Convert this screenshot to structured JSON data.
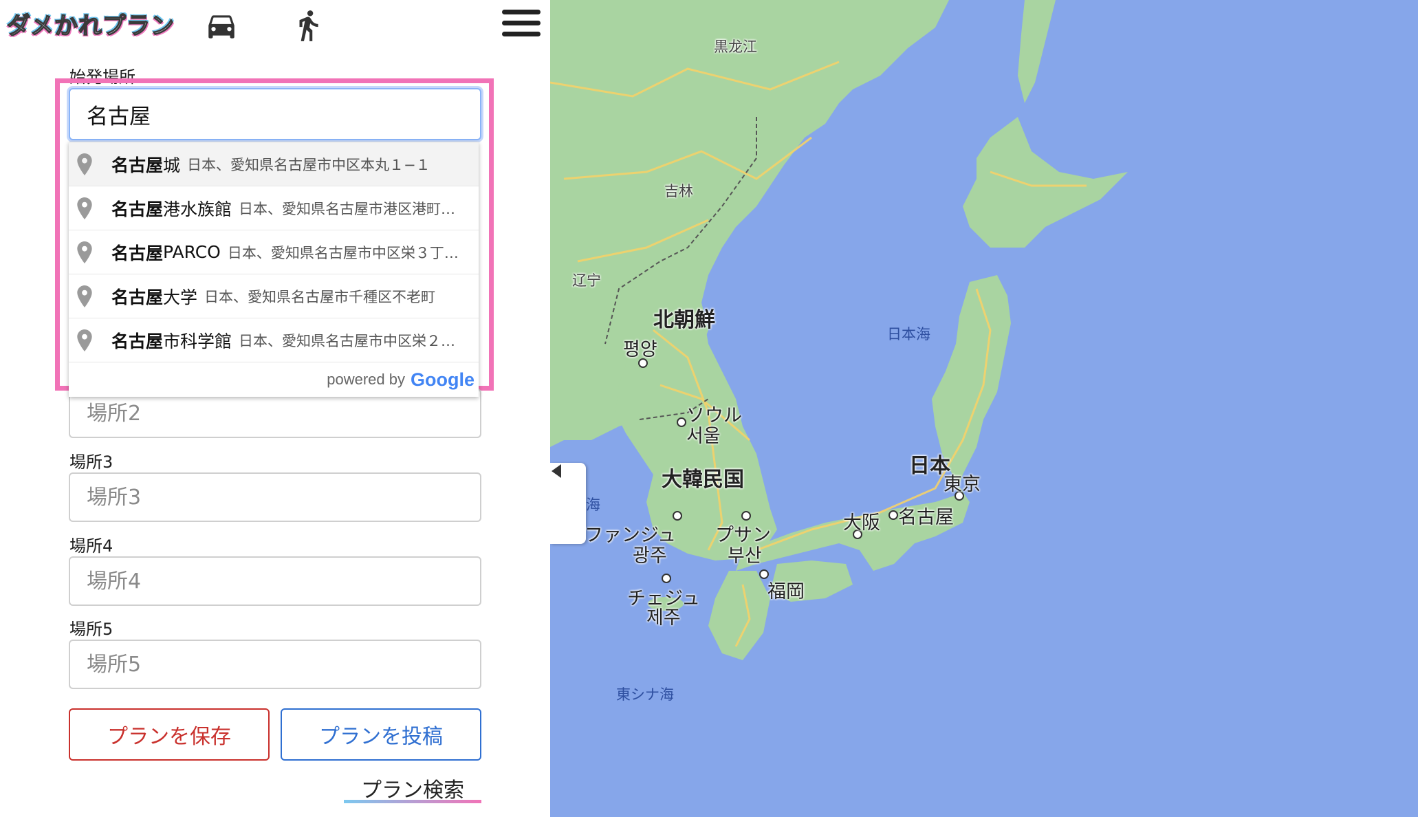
{
  "app": {
    "logo_text": "ダメかれプラン"
  },
  "header": {
    "car_icon": "car-icon",
    "walk_icon": "walk-icon",
    "menu_icon": "hamburger-menu-icon"
  },
  "form": {
    "start": {
      "label": "始発場所",
      "value": "名古屋"
    },
    "autocomplete": {
      "items": [
        {
          "match": "名古屋",
          "rest": "城",
          "address": "日本、愛知県名古屋市中区本丸１−１"
        },
        {
          "match": "名古屋",
          "rest": "港水族館",
          "address": "日本、愛知県名古屋市港区港町…"
        },
        {
          "match": "名古屋",
          "rest": "PARCO",
          "address": "日本、愛知県名古屋市中区栄３丁…"
        },
        {
          "match": "名古屋",
          "rest": "大学",
          "address": "日本、愛知県名古屋市千種区不老町"
        },
        {
          "match": "名古屋",
          "rest": "市科学館",
          "address": "日本、愛知県名古屋市中区栄２…"
        }
      ],
      "powered_by": "powered by",
      "google": "Google"
    },
    "place2": {
      "placeholder": "場所2"
    },
    "place3": {
      "label": "場所3",
      "placeholder": "場所3"
    },
    "place4": {
      "label": "場所4",
      "placeholder": "場所4"
    },
    "place5": {
      "label": "場所5",
      "placeholder": "場所5"
    },
    "save_label": "プランを保存",
    "post_label": "プランを投稿",
    "search_label": "プラン検索"
  },
  "colors": {
    "highlight": "#f173b7",
    "save": "#c9302c",
    "post": "#2f6fd1",
    "sea": "#86a6ea",
    "land": "#a8d5a0"
  },
  "map": {
    "labels": {
      "heilongjiang": "黒龙江",
      "jilin": "吉林",
      "liaoning": "辽宁",
      "north_korea": "北朝鮮",
      "pyongyang": "평양",
      "seoul_kana": "ソウル",
      "seoul_ko": "서울",
      "south_korea": "大韓民国",
      "gwangju_kana": "ファンジュ",
      "gwangju_ko": "광주",
      "busan_kana": "プサン",
      "busan_ko": "부산",
      "jeju_kana": "チェジュ",
      "jeju_ko": "제주",
      "fukuoka": "福岡",
      "osaka": "大阪",
      "nagoya": "名古屋",
      "japan": "日本",
      "tokyo": "東京",
      "sea_of_japan": "日本海",
      "east_china_sea": "東シナ海",
      "yellow_sea_fragment": "海"
    }
  }
}
